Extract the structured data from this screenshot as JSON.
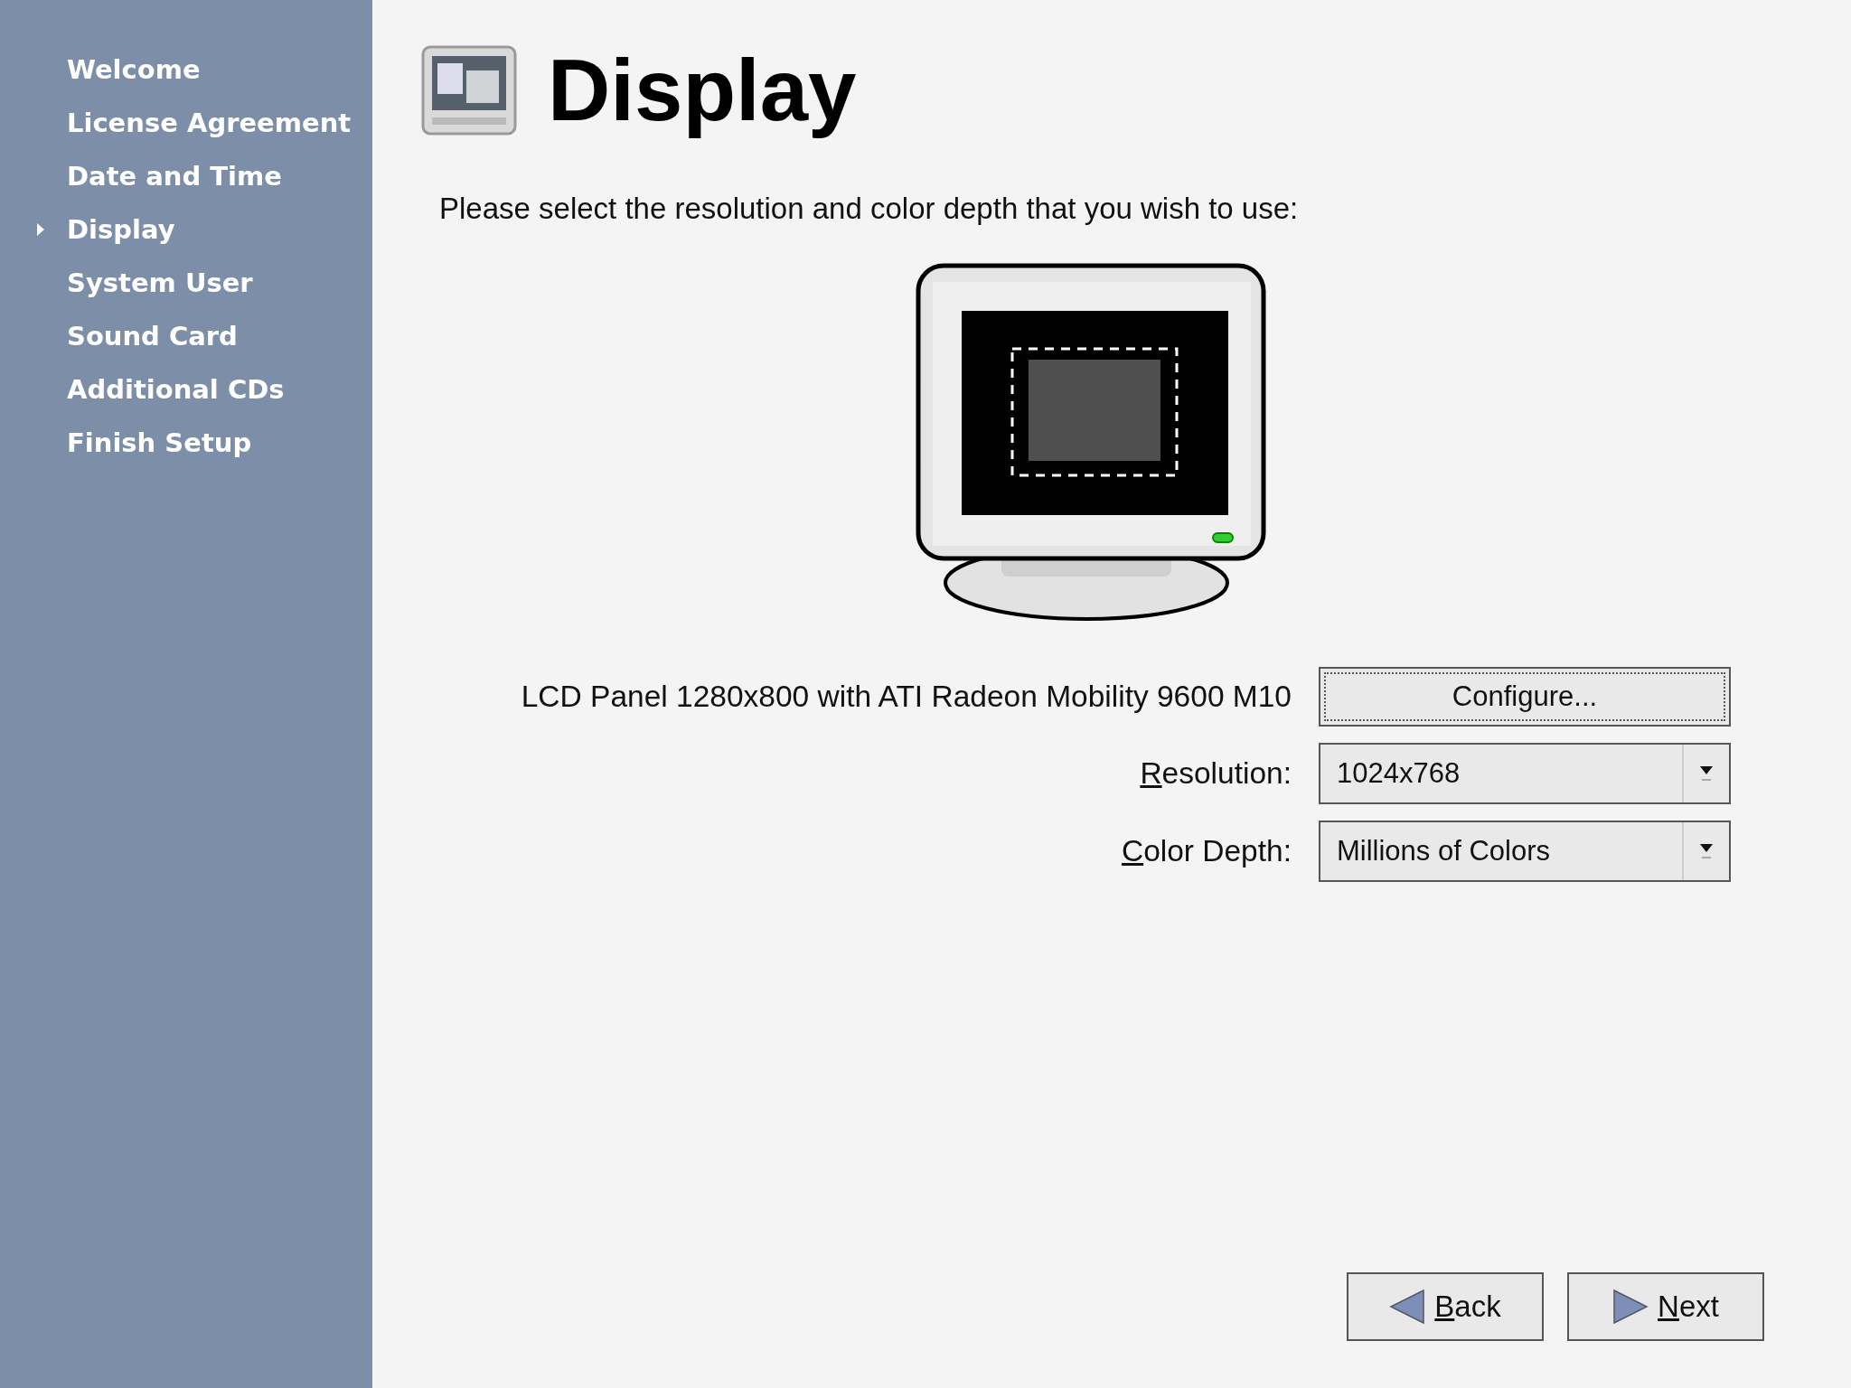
{
  "sidebar": {
    "items": [
      {
        "label": "Welcome",
        "selected": false
      },
      {
        "label": "License Agreement",
        "selected": false
      },
      {
        "label": "Date and Time",
        "selected": false
      },
      {
        "label": "Display",
        "selected": true
      },
      {
        "label": "System User",
        "selected": false
      },
      {
        "label": "Sound Card",
        "selected": false
      },
      {
        "label": "Additional CDs",
        "selected": false
      },
      {
        "label": "Finish Setup",
        "selected": false
      }
    ]
  },
  "page": {
    "title": "Display",
    "instruction": "Please select the resolution and color depth that you wish to use:"
  },
  "device": {
    "label": "LCD Panel 1280x800 with ATI Radeon Mobility 9600 M10",
    "button": "Configure..."
  },
  "fields": [
    {
      "label": "Resolution:",
      "value": "1024x768"
    },
    {
      "label": "Color Depth:",
      "value": "Millions of Colors"
    }
  ],
  "buttons": [
    {
      "kind": "back",
      "label": "Back"
    },
    {
      "kind": "next",
      "label": "Next"
    }
  ]
}
